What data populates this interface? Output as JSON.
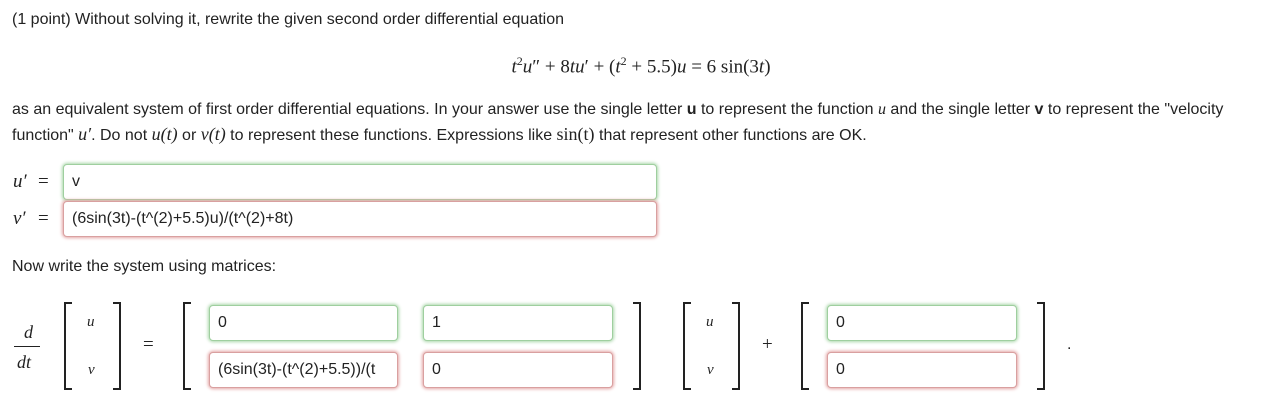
{
  "intro": "(1 point) Without solving it, rewrite the given second order differential equation",
  "equation": {
    "t": "t",
    "sq": "2",
    "u": "u",
    "dprime": "″",
    "plus1": " + 8",
    "tu": "tu",
    "prime": "′",
    "plus2": " + (",
    "t2": "t",
    "sq2": "2",
    "rest": " + 5.5)",
    "u2": "u",
    "eq": " = 6 sin(3",
    "t3": "t",
    "close": ")"
  },
  "paragraph": {
    "p1": "as an equivalent system of first order differential equations. In your answer use the single letter ",
    "u_bold": "u",
    "p2": " to represent the function ",
    "u_math": "u",
    "p3": " and the single letter ",
    "v_bold": "v",
    "p4": " to represent the \"velocity function\" ",
    "uprime_math": "u′",
    "p5": ". Do not ",
    "ut_math": "u(t)",
    "p6": " or ",
    "vt_math": "v(t)",
    "p7": " to represent these functions. Expressions like ",
    "sin_math": "sin(t)",
    "p8": " that represent other functions are OK."
  },
  "first_order": {
    "uprime_label": "u′",
    "eq": "=",
    "uprime_value": "v",
    "vprime_label": "v′",
    "vprime_value": "(6sin(3t)-(t^(2)+5.5)u)/(t^(2)+8t)"
  },
  "matrix_prompt": "Now write the system using matrices:",
  "matrix": {
    "d": "d",
    "dt": "dt",
    "u": "u",
    "v": "v",
    "equals": "=",
    "plus": "+",
    "period": ".",
    "a11": "0",
    "a12": "1",
    "a21": "(6sin(3t)-(t^(2)+5.5))/(t",
    "a22": "0",
    "b1": "0",
    "b2": "0"
  }
}
